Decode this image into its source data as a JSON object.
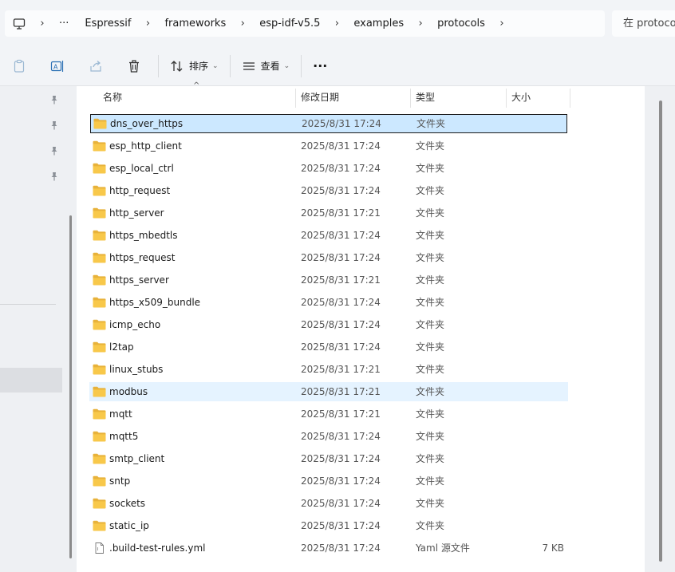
{
  "breadcrumb": {
    "overflow": "···",
    "items": [
      "Espressif",
      "frameworks",
      "esp-idf-v5.5",
      "examples",
      "protocols"
    ]
  },
  "search": {
    "placeholder": "在 protocols 中搜索"
  },
  "toolbar": {
    "sort_label": "排序",
    "view_label": "查看",
    "more_label": "···"
  },
  "columns": {
    "name": "名称",
    "modified": "修改日期",
    "type": "类型",
    "size": "大小"
  },
  "files": [
    {
      "name": "dns_over_https",
      "modified": "2025/8/31 17:24",
      "type": "文件夹",
      "size": "",
      "kind": "folder",
      "state": "selected"
    },
    {
      "name": "esp_http_client",
      "modified": "2025/8/31 17:24",
      "type": "文件夹",
      "size": "",
      "kind": "folder",
      "state": ""
    },
    {
      "name": "esp_local_ctrl",
      "modified": "2025/8/31 17:24",
      "type": "文件夹",
      "size": "",
      "kind": "folder",
      "state": ""
    },
    {
      "name": "http_request",
      "modified": "2025/8/31 17:24",
      "type": "文件夹",
      "size": "",
      "kind": "folder",
      "state": ""
    },
    {
      "name": "http_server",
      "modified": "2025/8/31 17:21",
      "type": "文件夹",
      "size": "",
      "kind": "folder",
      "state": ""
    },
    {
      "name": "https_mbedtls",
      "modified": "2025/8/31 17:24",
      "type": "文件夹",
      "size": "",
      "kind": "folder",
      "state": ""
    },
    {
      "name": "https_request",
      "modified": "2025/8/31 17:24",
      "type": "文件夹",
      "size": "",
      "kind": "folder",
      "state": ""
    },
    {
      "name": "https_server",
      "modified": "2025/8/31 17:21",
      "type": "文件夹",
      "size": "",
      "kind": "folder",
      "state": ""
    },
    {
      "name": "https_x509_bundle",
      "modified": "2025/8/31 17:24",
      "type": "文件夹",
      "size": "",
      "kind": "folder",
      "state": ""
    },
    {
      "name": "icmp_echo",
      "modified": "2025/8/31 17:24",
      "type": "文件夹",
      "size": "",
      "kind": "folder",
      "state": ""
    },
    {
      "name": "l2tap",
      "modified": "2025/8/31 17:24",
      "type": "文件夹",
      "size": "",
      "kind": "folder",
      "state": ""
    },
    {
      "name": "linux_stubs",
      "modified": "2025/8/31 17:21",
      "type": "文件夹",
      "size": "",
      "kind": "folder",
      "state": ""
    },
    {
      "name": "modbus",
      "modified": "2025/8/31 17:21",
      "type": "文件夹",
      "size": "",
      "kind": "folder",
      "state": "hover"
    },
    {
      "name": "mqtt",
      "modified": "2025/8/31 17:21",
      "type": "文件夹",
      "size": "",
      "kind": "folder",
      "state": ""
    },
    {
      "name": "mqtt5",
      "modified": "2025/8/31 17:24",
      "type": "文件夹",
      "size": "",
      "kind": "folder",
      "state": ""
    },
    {
      "name": "smtp_client",
      "modified": "2025/8/31 17:24",
      "type": "文件夹",
      "size": "",
      "kind": "folder",
      "state": ""
    },
    {
      "name": "sntp",
      "modified": "2025/8/31 17:24",
      "type": "文件夹",
      "size": "",
      "kind": "folder",
      "state": ""
    },
    {
      "name": "sockets",
      "modified": "2025/8/31 17:24",
      "type": "文件夹",
      "size": "",
      "kind": "folder",
      "state": ""
    },
    {
      "name": "static_ip",
      "modified": "2025/8/31 17:24",
      "type": "文件夹",
      "size": "",
      "kind": "folder",
      "state": ""
    },
    {
      "name": ".build-test-rules.yml",
      "modified": "2025/8/31 17:24",
      "type": "Yaml 源文件",
      "size": "7 KB",
      "kind": "file",
      "state": ""
    }
  ],
  "colors": {
    "selected_bg": "#cce8ff",
    "hover_bg": "#e5f3ff",
    "folder": "#f8c84a"
  }
}
